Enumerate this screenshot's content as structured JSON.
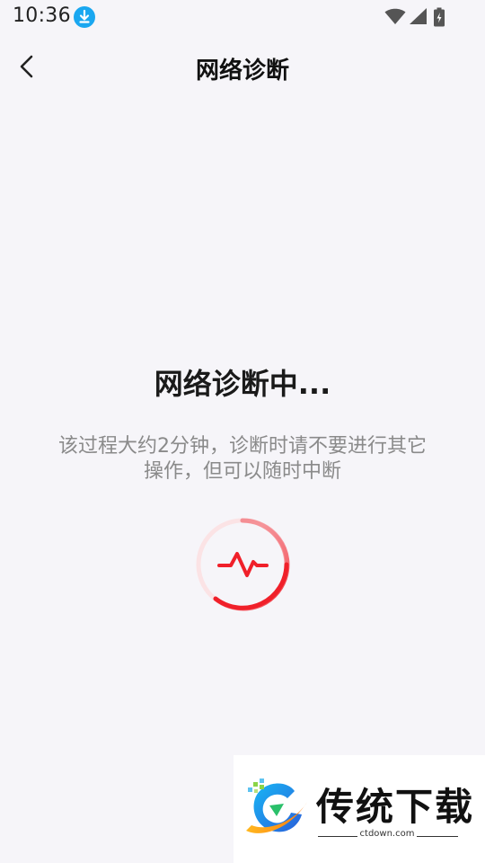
{
  "status_bar": {
    "time": "10:36"
  },
  "header": {
    "title": "网络诊断"
  },
  "main": {
    "status_heading": "网络诊断中...",
    "description_line1": "该过程大约2分钟，诊断时请不要进行其它",
    "description_line2": "操作，但可以随时中断"
  },
  "watermark": {
    "title": "传统下载",
    "domain": "ctdown.com"
  },
  "colors": {
    "accent": "#f0202a",
    "background": "#f6f5f9",
    "download_badge": "#1aa7f0"
  }
}
